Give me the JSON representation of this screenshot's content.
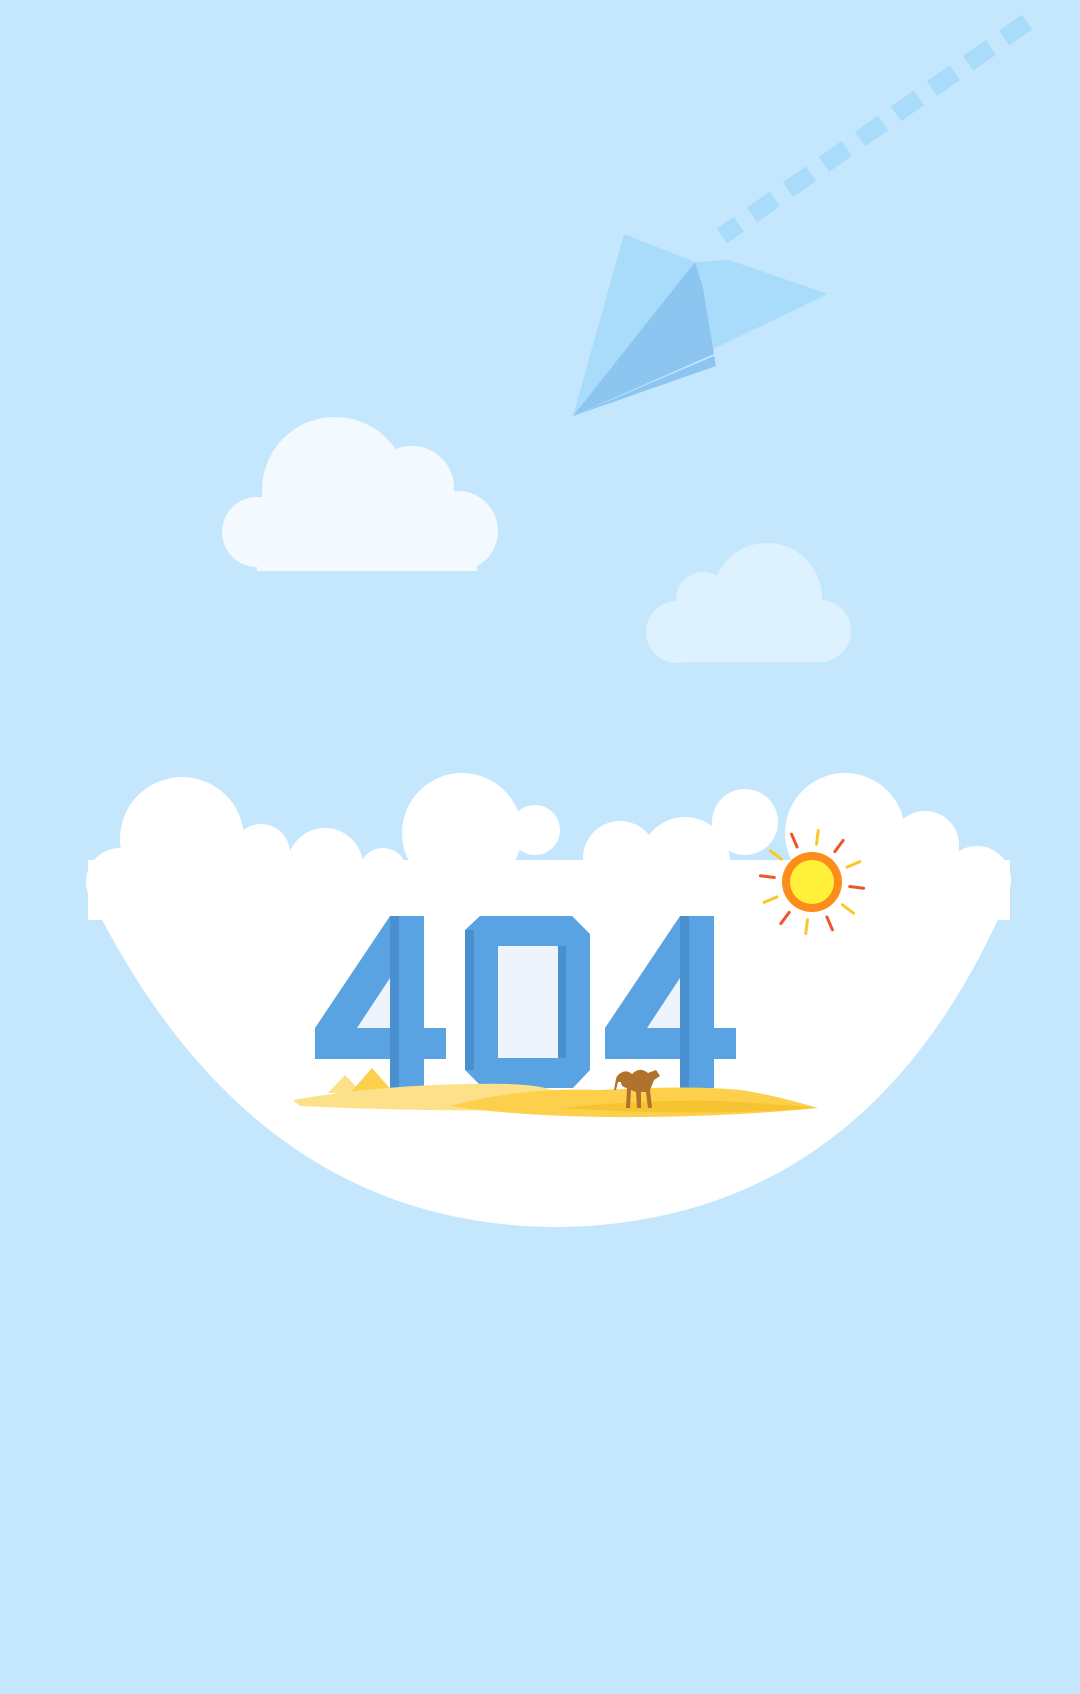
{
  "colors": {
    "sky": "#c4e7fe",
    "cloud_white": "#ffffff",
    "cloud_small_left": "#f3faff",
    "cloud_small_right": "#ddf1fe",
    "plane_light": "#a9dbfb",
    "plane_mid": "#8cc6f0",
    "plane_trail": "#a9dbfb",
    "digit_blue": "#5aa3e2",
    "digit_blue_dark": "#4a8fd0",
    "digit_counter": "#eef4fb",
    "sand_light": "#fde08a",
    "sand": "#fdd04c",
    "sand_dark": "#f7c431",
    "sun_core": "#fff13a",
    "sun_ring": "#fd8d1a",
    "sun_ray_red": "#f0542a",
    "sun_ray_yellow": "#fcc72a",
    "camel": "#b0722c"
  },
  "illustration": {
    "error_code": "404",
    "icons": [
      "paper-plane-icon",
      "cloud-icon",
      "sun-icon",
      "camel-icon",
      "pyramid-icon"
    ]
  }
}
